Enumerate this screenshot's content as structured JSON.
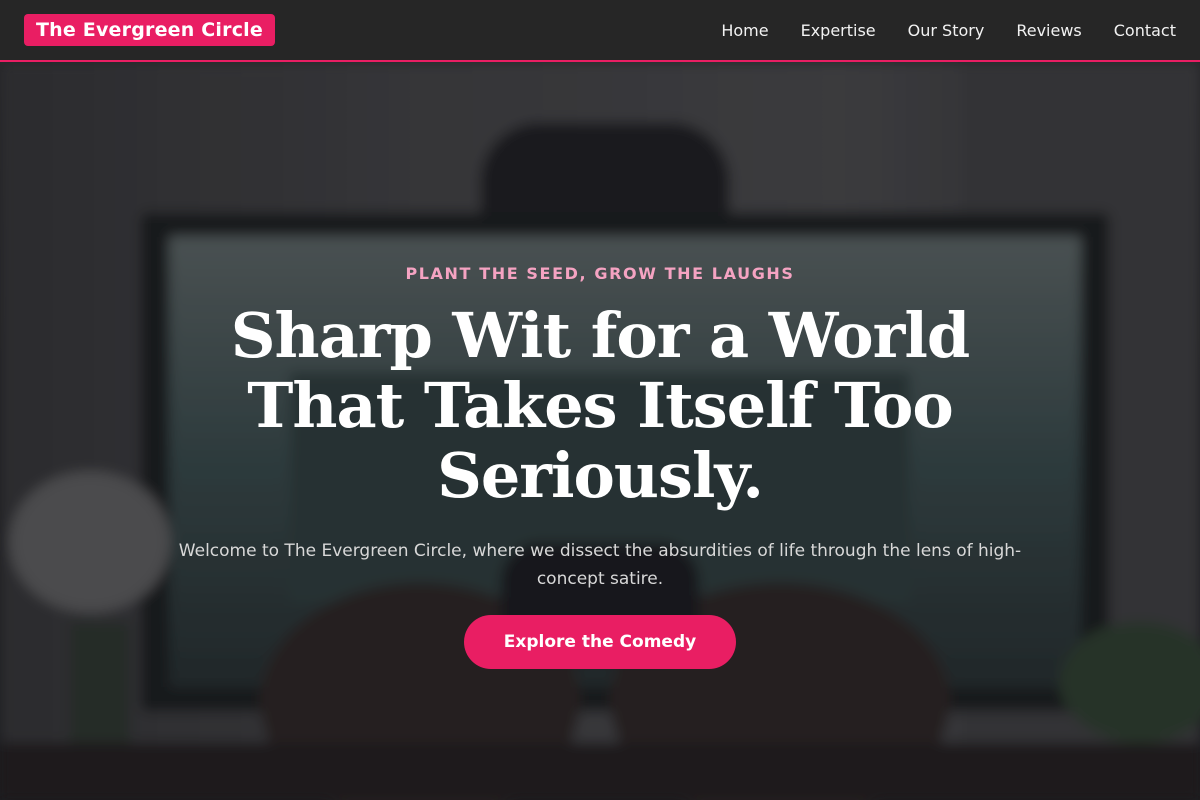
{
  "colors": {
    "accent": "#e91e63",
    "header_bg": "#262626",
    "eyebrow": "#f5a3c2"
  },
  "header": {
    "logo": "The Evergreen Circle",
    "nav": [
      "Home",
      "Expertise",
      "Our Story",
      "Reviews",
      "Contact"
    ]
  },
  "hero": {
    "eyebrow": "PLANT THE SEED, GROW THE LAUGHS",
    "headline": "Sharp Wit for a World That Takes Itself Too Seriously.",
    "lead": "Welcome to The Evergreen Circle, where we dissect the absurdities of life through the lens of high-concept satire.",
    "cta": "Explore the Comedy",
    "background_image": "hands-holding-game-controller-in-front-of-monitor"
  }
}
